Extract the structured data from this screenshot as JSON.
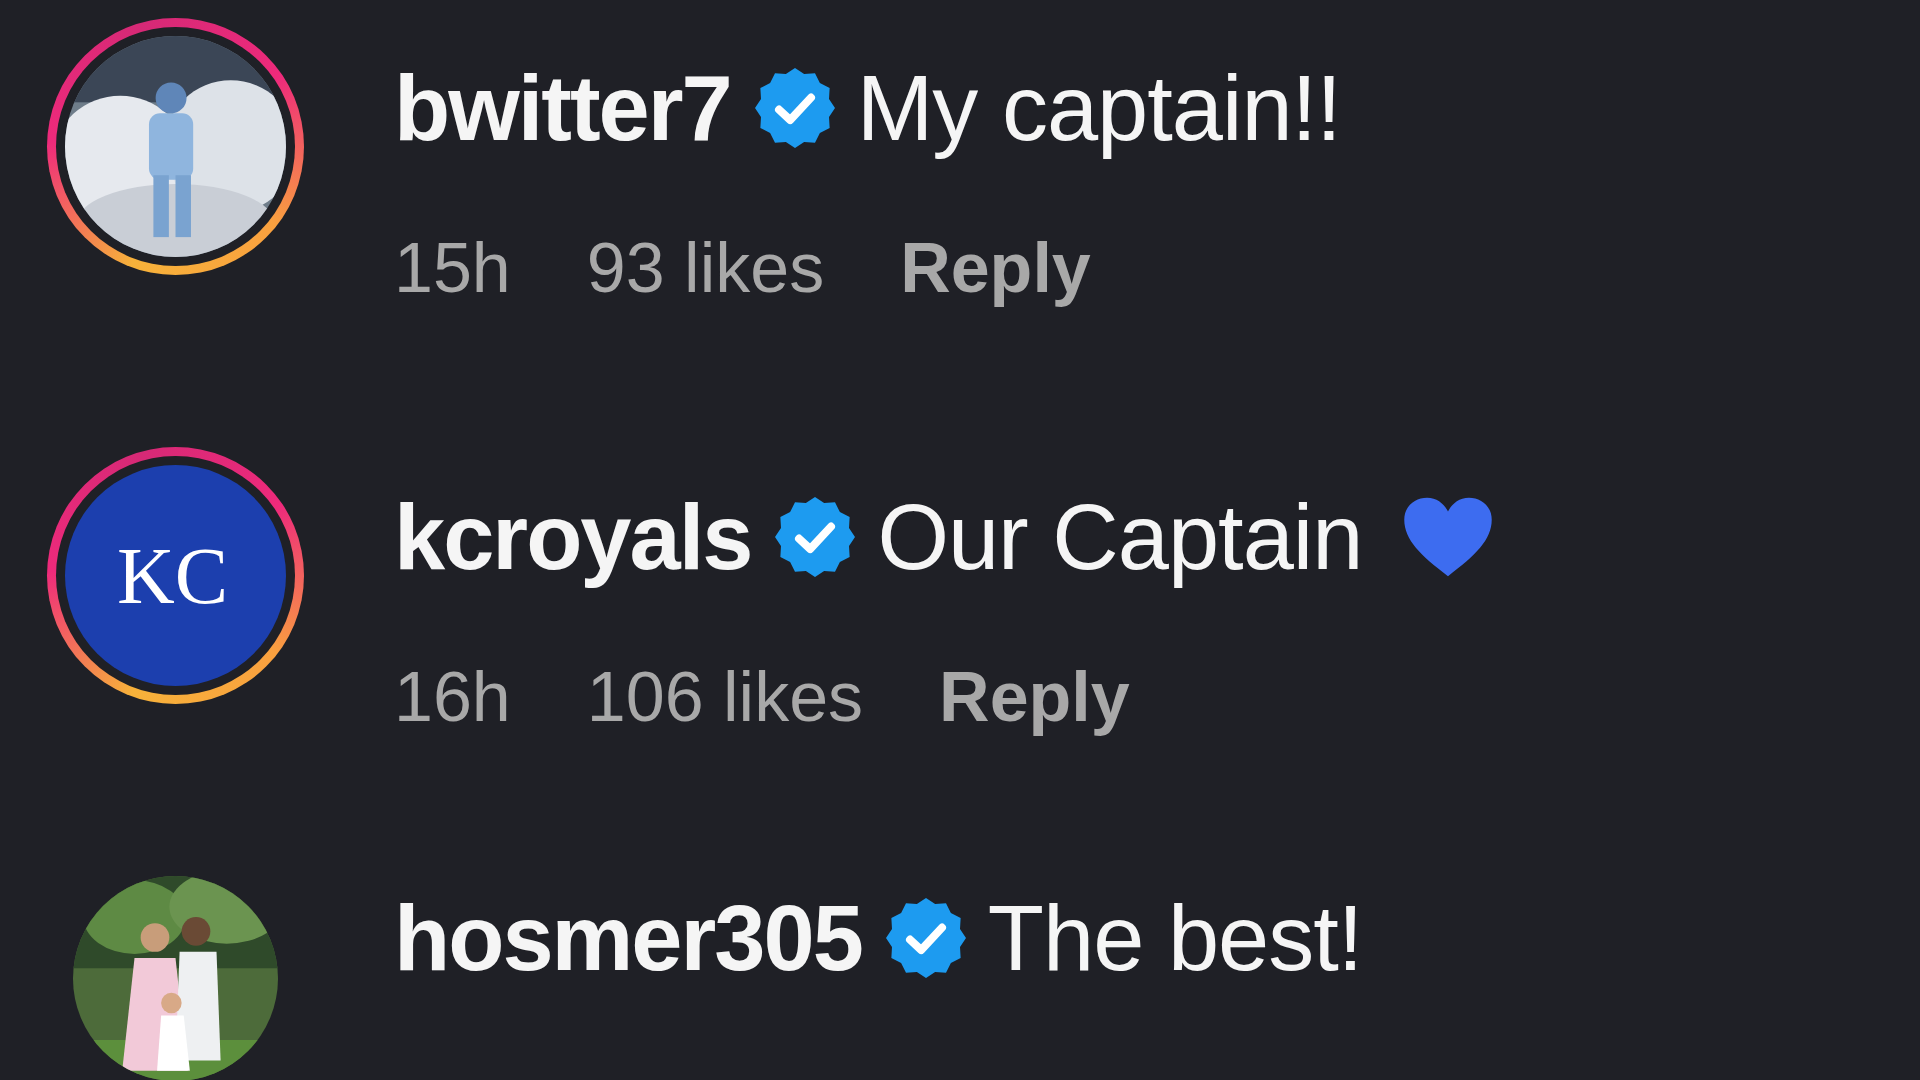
{
  "comments": [
    {
      "avatar": {
        "kind": "picture",
        "story_ring": true
      },
      "username": "bwitter7",
      "verified": true,
      "text": "My captain!!",
      "kind": "plain",
      "time": "15h",
      "likes": "93 likes",
      "reply": "Reply"
    },
    {
      "avatar": {
        "kind": "logo",
        "story_ring": true,
        "logo_text": "KC"
      },
      "username": "kcroyals",
      "verified": true,
      "text": "Our Captain",
      "kind": "with-heart",
      "time": "16h",
      "likes": "106 likes",
      "reply": "Reply"
    },
    {
      "avatar": {
        "kind": "picture2",
        "story_ring": false
      },
      "username": "hosmer305",
      "verified": true,
      "text": "The best!",
      "kind": "plain"
    }
  ]
}
